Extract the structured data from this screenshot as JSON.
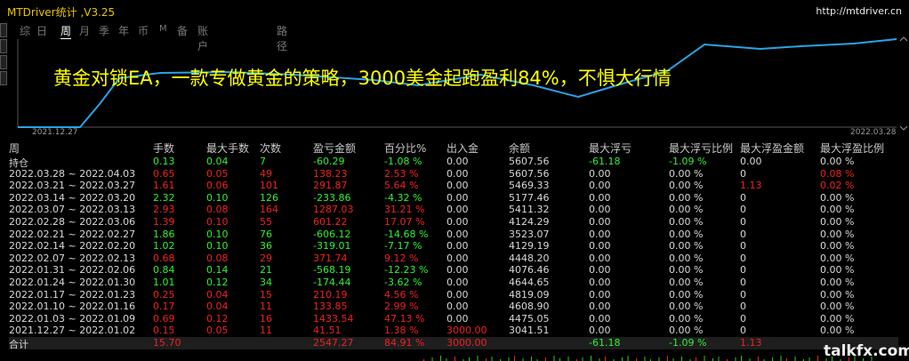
{
  "window": {
    "title": "MTDriver统计 ,V3.25",
    "url": "http://mtdriver.cn"
  },
  "tabs": [
    {
      "label": "综"
    },
    {
      "label": "日"
    },
    {
      "label": "周"
    },
    {
      "label": "月"
    },
    {
      "label": "季"
    },
    {
      "label": "年"
    },
    {
      "label": "币"
    },
    {
      "label": "M"
    },
    {
      "label": "备"
    },
    {
      "label": "账户"
    },
    {
      "label": "路径"
    }
  ],
  "active_tab": "周",
  "overlay_text": "黄金对锁EA，一款专做黄金的策略，3000美金起跑盈利84%，不惧大行情",
  "chart": {
    "start_label": "2021.12.27",
    "end_label": "2022.03.28",
    "line_color": "#29a3e6"
  },
  "table": {
    "headers": [
      "周",
      "手数",
      "最大手数",
      "次数",
      "盈亏金额",
      "百分比%",
      "出入金",
      "余额",
      "最大浮亏",
      "最大浮亏比例",
      "最大浮盈金额",
      "最大浮盈比例"
    ],
    "rows": [
      {
        "c": [
          "持仓",
          "0.13",
          "0.04",
          "7",
          "-60.29",
          "-1.08 %",
          "0.00",
          "5607.56",
          "-61.18",
          "-1.09 %",
          "0.00",
          "0.00 %"
        ],
        "k": [
          "w",
          "g",
          "g",
          "g",
          "g",
          "g",
          "w",
          "w",
          "g",
          "g",
          "w",
          "w"
        ]
      },
      {
        "c": [
          "2022.03.28 ~ 2022.04.03",
          "0.65",
          "0.05",
          "49",
          "138.23",
          "2.53 %",
          "0.00",
          "5607.56",
          "0.00",
          "0.00 %",
          "0",
          "0.08 %"
        ],
        "k": [
          "w",
          "r",
          "r",
          "r",
          "r",
          "r",
          "w",
          "w",
          "w",
          "w",
          "w",
          "r"
        ]
      },
      {
        "c": [
          "2022.03.21 ~ 2022.03.27",
          "1.61",
          "0.06",
          "101",
          "291.87",
          "5.64 %",
          "0.00",
          "5469.33",
          "0.00",
          "0.00 %",
          "1.13",
          "0.02 %"
        ],
        "k": [
          "w",
          "r",
          "r",
          "r",
          "r",
          "r",
          "w",
          "w",
          "w",
          "w",
          "r",
          "r"
        ]
      },
      {
        "c": [
          "2022.03.14 ~ 2022.03.20",
          "2.32",
          "0.10",
          "126",
          "-233.86",
          "-4.32 %",
          "0.00",
          "5177.46",
          "0.00",
          "0.00 %",
          "0",
          "0.00 %"
        ],
        "k": [
          "w",
          "g",
          "g",
          "g",
          "g",
          "g",
          "w",
          "w",
          "w",
          "w",
          "w",
          "w"
        ]
      },
      {
        "c": [
          "2022.03.07 ~ 2022.03.13",
          "2.93",
          "0.08",
          "164",
          "1287.03",
          "31.21 %",
          "0.00",
          "5411.32",
          "0.00",
          "0.00 %",
          "0",
          "0.00 %"
        ],
        "k": [
          "w",
          "r",
          "r",
          "r",
          "r",
          "r",
          "w",
          "w",
          "w",
          "w",
          "w",
          "w"
        ]
      },
      {
        "c": [
          "2022.02.28 ~ 2022.03.06",
          "1.39",
          "0.10",
          "55",
          "601.22",
          "17.07 %",
          "0.00",
          "4124.29",
          "0.00",
          "0.00 %",
          "0",
          "0.00 %"
        ],
        "k": [
          "w",
          "r",
          "r",
          "r",
          "r",
          "r",
          "w",
          "w",
          "w",
          "w",
          "w",
          "w"
        ]
      },
      {
        "c": [
          "2022.02.21 ~ 2022.02.27",
          "1.86",
          "0.10",
          "76",
          "-606.12",
          "-14.68 %",
          "0.00",
          "3523.07",
          "0.00",
          "0.00 %",
          "0",
          "0.00 %"
        ],
        "k": [
          "w",
          "g",
          "g",
          "g",
          "g",
          "g",
          "w",
          "w",
          "w",
          "w",
          "w",
          "w"
        ]
      },
      {
        "c": [
          "2022.02.14 ~ 2022.02.20",
          "1.02",
          "0.10",
          "36",
          "-319.01",
          "-7.17 %",
          "0.00",
          "4129.19",
          "0.00",
          "0.00 %",
          "0",
          "0.00 %"
        ],
        "k": [
          "w",
          "g",
          "g",
          "g",
          "g",
          "g",
          "w",
          "w",
          "w",
          "w",
          "w",
          "w"
        ]
      },
      {
        "c": [
          "2022.02.07 ~ 2022.02.13",
          "0.68",
          "0.08",
          "29",
          "371.74",
          "9.12 %",
          "0.00",
          "4448.20",
          "0.00",
          "0.00 %",
          "0",
          "0.00 %"
        ],
        "k": [
          "w",
          "r",
          "r",
          "r",
          "r",
          "r",
          "w",
          "w",
          "w",
          "w",
          "w",
          "w"
        ]
      },
      {
        "c": [
          "2022.01.31 ~ 2022.02.06",
          "0.84",
          "0.14",
          "21",
          "-568.19",
          "-12.23 %",
          "0.00",
          "4076.46",
          "0.00",
          "0.00 %",
          "0",
          "0.00 %"
        ],
        "k": [
          "w",
          "g",
          "g",
          "g",
          "g",
          "g",
          "w",
          "w",
          "w",
          "w",
          "w",
          "w"
        ]
      },
      {
        "c": [
          "2022.01.24 ~ 2022.01.30",
          "1.01",
          "0.12",
          "34",
          "-174.44",
          "-3.62 %",
          "0.00",
          "4644.65",
          "0.00",
          "0.00 %",
          "0",
          "0.00 %"
        ],
        "k": [
          "w",
          "g",
          "g",
          "g",
          "g",
          "g",
          "w",
          "w",
          "w",
          "w",
          "w",
          "w"
        ]
      },
      {
        "c": [
          "2022.01.17 ~ 2022.01.23",
          "0.25",
          "0.04",
          "15",
          "210.19",
          "4.56 %",
          "0.00",
          "4819.09",
          "0.00",
          "0.00 %",
          "0",
          "0.00 %"
        ],
        "k": [
          "w",
          "r",
          "r",
          "r",
          "r",
          "r",
          "w",
          "w",
          "w",
          "w",
          "w",
          "w"
        ]
      },
      {
        "c": [
          "2022.01.10 ~ 2022.01.16",
          "0.17",
          "0.04",
          "11",
          "133.85",
          "2.99 %",
          "0.00",
          "4608.90",
          "0.00",
          "0.00 %",
          "0",
          "0.00 %"
        ],
        "k": [
          "w",
          "r",
          "r",
          "r",
          "r",
          "r",
          "w",
          "w",
          "w",
          "w",
          "w",
          "w"
        ]
      },
      {
        "c": [
          "2022.01.03 ~ 2022.01.09",
          "0.69",
          "0.12",
          "16",
          "1433.54",
          "47.13 %",
          "0.00",
          "4475.05",
          "0.00",
          "0.00 %",
          "0",
          "0.00 %"
        ],
        "k": [
          "w",
          "r",
          "r",
          "r",
          "r",
          "r",
          "w",
          "w",
          "w",
          "w",
          "w",
          "w"
        ]
      },
      {
        "c": [
          "2021.12.27 ~ 2022.01.02",
          "0.15",
          "0.05",
          "11",
          "41.51",
          "1.38 %",
          "3000.00",
          "3041.51",
          "0.00",
          "0.00 %",
          "0",
          "0.00 %"
        ],
        "k": [
          "w",
          "r",
          "r",
          "r",
          "r",
          "r",
          "r",
          "w",
          "w",
          "w",
          "w",
          "w"
        ]
      },
      {
        "c": [
          "合计",
          "15.70",
          "",
          "",
          "2547.27",
          "84.91 %",
          "3000.00",
          "",
          "-61.18",
          "-1.09 %",
          "1.13",
          ""
        ],
        "k": [
          "w",
          "r",
          "w",
          "w",
          "r",
          "r",
          "r",
          "w",
          "g",
          "g",
          "r",
          "r"
        ]
      }
    ]
  },
  "watermark": "talkfx.com"
}
